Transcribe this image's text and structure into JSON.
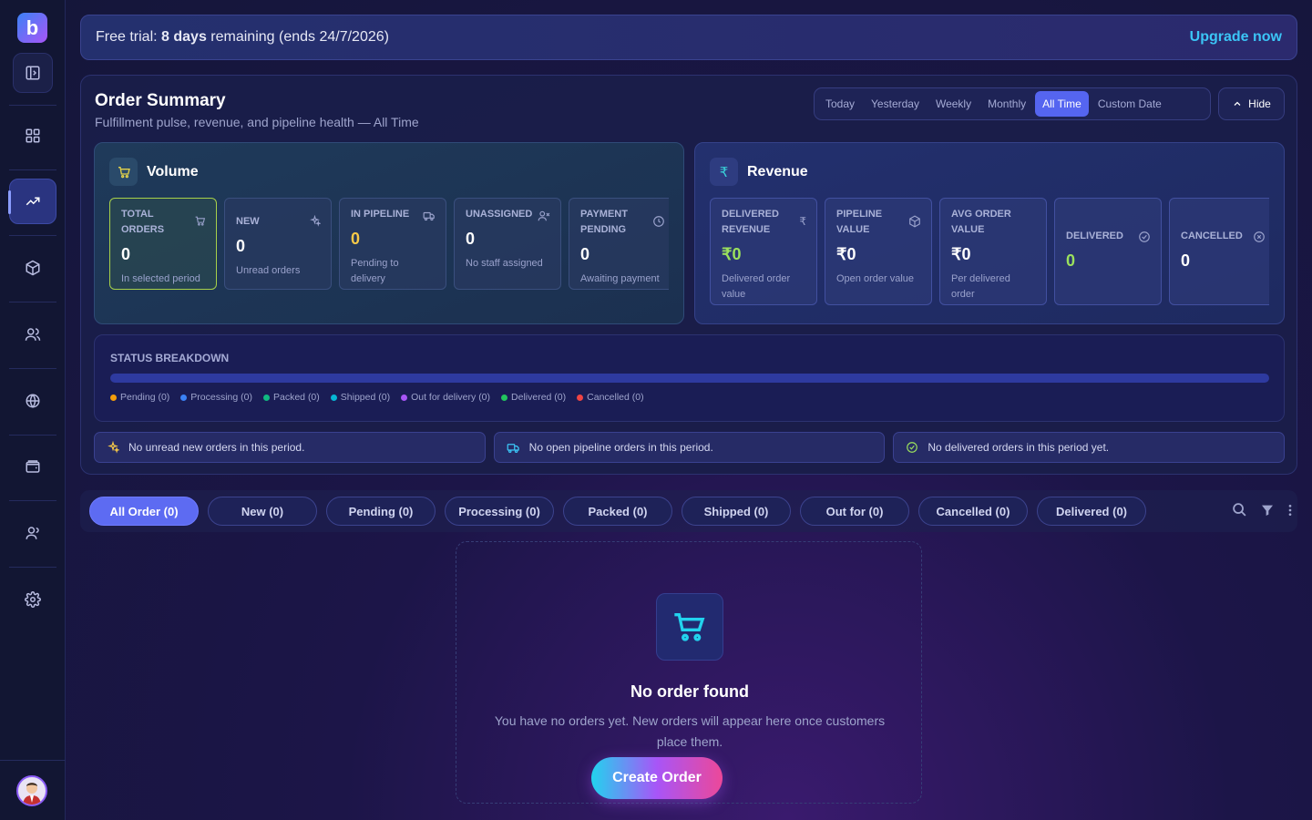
{
  "sidebar": {
    "logo": "b",
    "items": [
      "panel-toggle",
      "dashboard",
      "orders",
      "products",
      "customers",
      "website",
      "wallet",
      "staff",
      "settings"
    ]
  },
  "trial": {
    "prefix": "Free trial:",
    "days": "8 days",
    "suffix": "remaining (ends 24/7/2026)",
    "upgrade": "Upgrade now"
  },
  "summary": {
    "title": "Order Summary",
    "subtitle": "Fulfillment pulse, revenue, and pipeline health — All Time",
    "filters": [
      "Today",
      "Yesterday",
      "Weekly",
      "Monthly",
      "All Time",
      "Custom Date"
    ],
    "active_filter": "All Time",
    "hide": "Hide"
  },
  "volume": {
    "title": "Volume",
    "cards": [
      {
        "label": "TOTAL ORDERS",
        "value": "0",
        "note": "In selected period"
      },
      {
        "label": "NEW",
        "value": "0",
        "note": "Unread orders"
      },
      {
        "label": "IN PIPELINE",
        "value": "0",
        "note": "Pending to delivery"
      },
      {
        "label": "UNASSIGNED",
        "value": "0",
        "note": "No staff assigned"
      },
      {
        "label": "PAYMENT PENDING",
        "value": "0",
        "note": "Awaiting payment"
      }
    ]
  },
  "revenue": {
    "title": "Revenue",
    "cards": [
      {
        "label": "DELIVERED REVENUE",
        "value": "₹0",
        "note": "Delivered order value"
      },
      {
        "label": "PIPELINE VALUE",
        "value": "₹0",
        "note": "Open order value"
      },
      {
        "label": "AVG ORDER VALUE",
        "value": "₹0",
        "note": "Per delivered order"
      },
      {
        "label": "DELIVERED",
        "value": "0"
      },
      {
        "label": "CANCELLED",
        "value": "0"
      }
    ]
  },
  "breakdown": {
    "title": "STATUS BREAKDOWN",
    "legend": [
      {
        "label": "Pending (0)",
        "color": "#f59e0b"
      },
      {
        "label": "Processing (0)",
        "color": "#3b82f6"
      },
      {
        "label": "Packed (0)",
        "color": "#10b981"
      },
      {
        "label": "Shipped (0)",
        "color": "#06b6d4"
      },
      {
        "label": "Out for delivery (0)",
        "color": "#a855f7"
      },
      {
        "label": "Delivered (0)",
        "color": "#22c55e"
      },
      {
        "label": "Cancelled (0)",
        "color": "#ef4444"
      }
    ]
  },
  "notes": [
    "No unread new orders in this period.",
    "No open pipeline orders in this period.",
    "No delivered orders in this period yet."
  ],
  "tabs": [
    "All Order (0)",
    "New (0)",
    "Pending (0)",
    "Processing (0)",
    "Packed (0)",
    "Shipped (0)",
    "Out for (0)",
    "Cancelled (0)",
    "Delivered (0)"
  ],
  "empty": {
    "title": "No order found",
    "description": "You have no orders yet. New orders will appear here once customers place them.",
    "button": "Create Order"
  }
}
